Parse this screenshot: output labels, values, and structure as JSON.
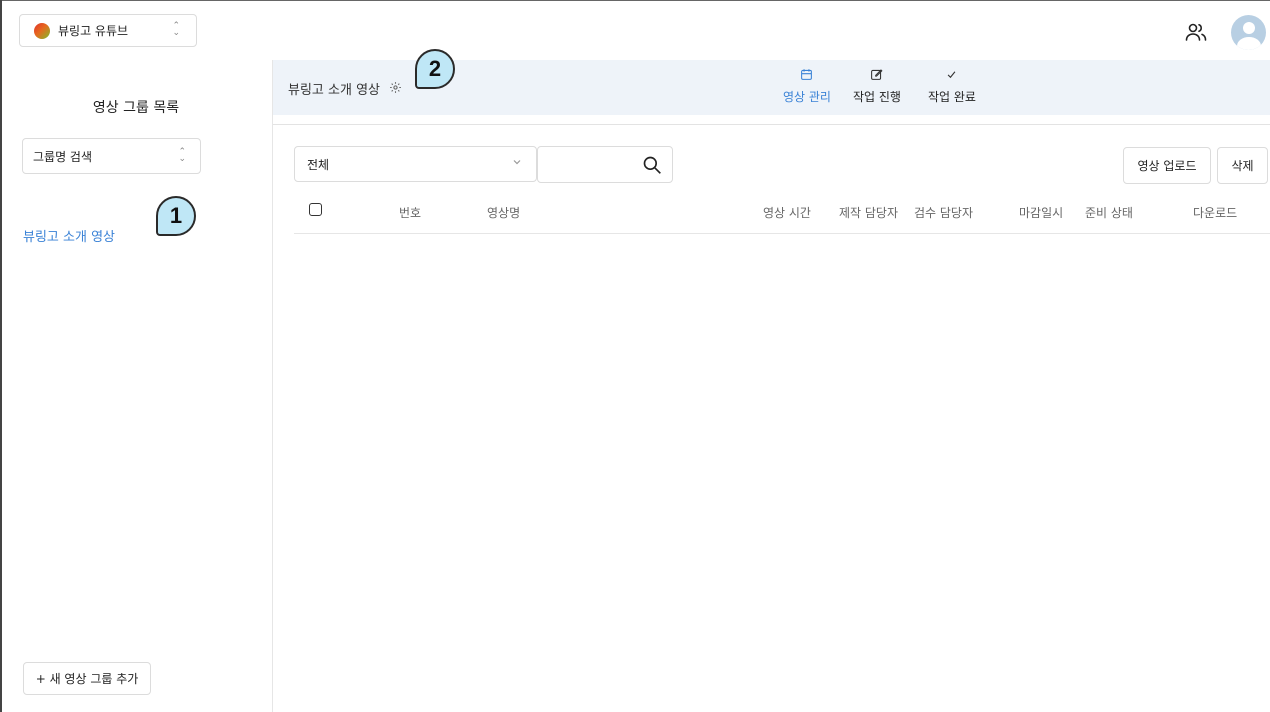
{
  "workspace": {
    "name": "뷰링고 유튜브"
  },
  "sidebar": {
    "title": "영상 그룹 목록",
    "search_label": "그룹명 검색",
    "groups": [
      {
        "label": "뷰링고 소개 영상"
      }
    ],
    "add_group_label": "+ 새 영상 그룹 추가"
  },
  "callouts": {
    "one": "1",
    "two": "2"
  },
  "header": {
    "group_title": "뷰링고 소개 영상",
    "tabs": [
      {
        "label": "영상 관리",
        "icon": "calendar-icon",
        "active": true
      },
      {
        "label": "작업 진행",
        "icon": "edit-icon",
        "active": false
      },
      {
        "label": "작업 완료",
        "icon": "check-icon",
        "active": false
      }
    ]
  },
  "toolbar": {
    "filter_value": "전체",
    "search_value": "",
    "upload_label": "영상 업로드",
    "delete_label": "삭제"
  },
  "table": {
    "columns": [
      "번호",
      "영상명",
      "영상 시간",
      "제작 담당자",
      "검수 담당자",
      "마감일시",
      "준비 상태",
      "다운로드"
    ],
    "rows": []
  },
  "colors": {
    "accent": "#3a82d6",
    "header_band": "#eef3f9",
    "callout": "#bfe7f6"
  }
}
